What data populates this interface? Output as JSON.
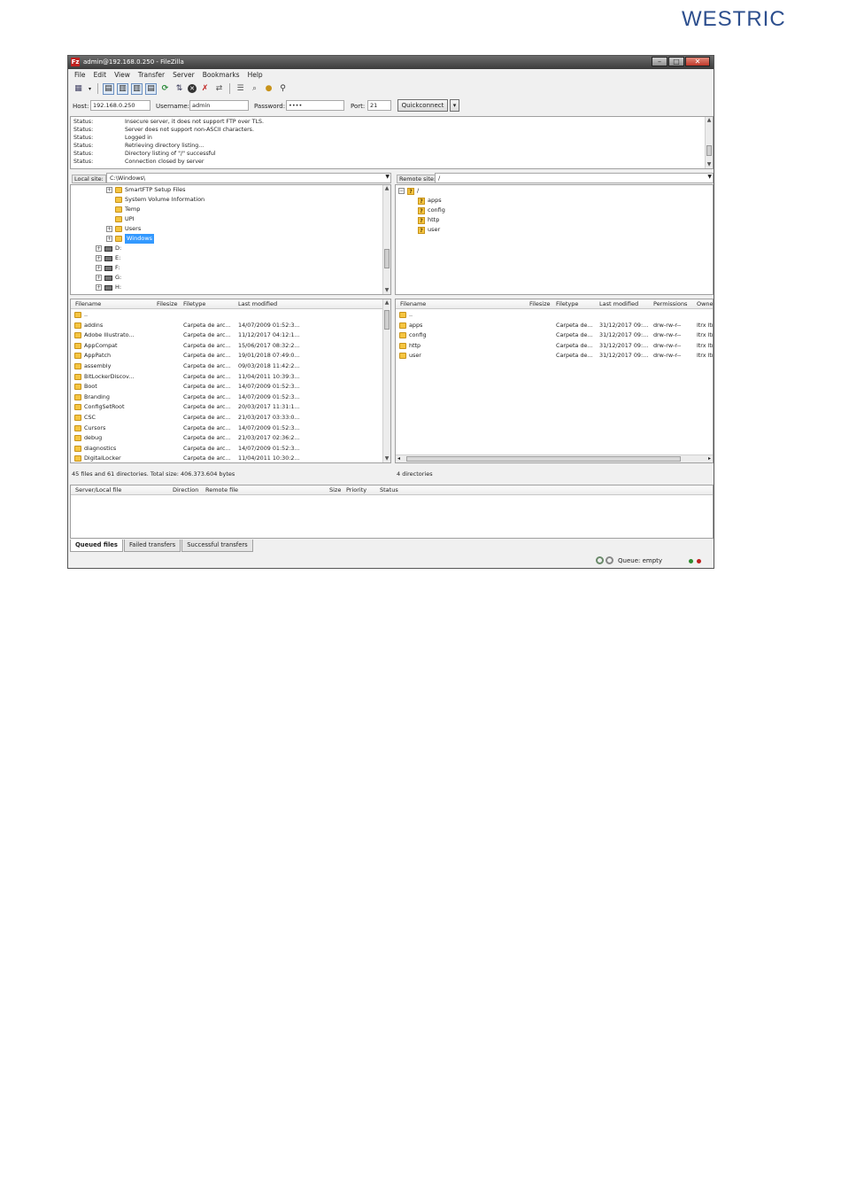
{
  "brand": "WESTRIC",
  "window": {
    "title": "admin@192.168.0.250 - FileZilla",
    "app_icon": "filezilla-icon",
    "controls": [
      "minimize",
      "maximize",
      "close"
    ]
  },
  "menu": [
    "File",
    "Edit",
    "View",
    "Transfer",
    "Server",
    "Bookmarks",
    "Help"
  ],
  "toolbar": {
    "icons": [
      "site-manager-icon",
      "dropdown-icon",
      "toggle-log-icon",
      "toggle-local-tree-icon",
      "toggle-remote-tree-icon",
      "toggle-queue-icon",
      "refresh-icon",
      "process-queue-icon",
      "cancel-icon",
      "disconnect-icon",
      "reconnect-icon",
      "filter-icon",
      "compare-icon",
      "sync-browse-icon",
      "search-icon"
    ]
  },
  "quickconnect": {
    "host_label": "Host:",
    "host_value": "192.168.0.250",
    "username_label": "Username:",
    "username_value": "admin",
    "password_label": "Password:",
    "password_value": "••••",
    "port_label": "Port:",
    "port_value": "21",
    "button_label": "Quickconnect",
    "dropdown_glyph": "▾"
  },
  "log": [
    {
      "key": "Status:",
      "msg": "Insecure server, it does not support FTP over TLS."
    },
    {
      "key": "Status:",
      "msg": "Server does not support non-ASCII characters."
    },
    {
      "key": "Status:",
      "msg": "Logged in"
    },
    {
      "key": "Status:",
      "msg": "Retrieving directory listing..."
    },
    {
      "key": "Status:",
      "msg": "Directory listing of \"/\" successful"
    },
    {
      "key": "Status:",
      "msg": "Connection closed by server"
    }
  ],
  "local": {
    "site_label": "Local site:",
    "site_path": "C:\\Windows\\",
    "tree": [
      {
        "label": "SmartFTP Setup Files",
        "type": "folder",
        "expander": "+"
      },
      {
        "label": "System Volume Information",
        "type": "folder",
        "expander": ""
      },
      {
        "label": "Temp",
        "type": "folder",
        "expander": ""
      },
      {
        "label": "UPI",
        "type": "folder",
        "expander": ""
      },
      {
        "label": "Users",
        "type": "folder",
        "expander": "+"
      },
      {
        "label": "Windows",
        "type": "folder",
        "expander": "+",
        "selected": true
      },
      {
        "label": "D:",
        "type": "drive",
        "expander": "+"
      },
      {
        "label": "E:",
        "type": "drive",
        "expander": "+"
      },
      {
        "label": "F:",
        "type": "drive",
        "expander": "+"
      },
      {
        "label": "G:",
        "type": "drive",
        "expander": "+"
      },
      {
        "label": "H:",
        "type": "drive",
        "expander": "+"
      }
    ],
    "columns": [
      "Filename",
      "Filesize",
      "Filetype",
      "Last modified"
    ],
    "files": [
      {
        "name": "..",
        "type": "",
        "modified": ""
      },
      {
        "name": "addins",
        "type": "Carpeta de arc...",
        "modified": "14/07/2009 01:52:3..."
      },
      {
        "name": "Adobe Illustrato...",
        "type": "Carpeta de arc...",
        "modified": "11/12/2017 04:12:1..."
      },
      {
        "name": "AppCompat",
        "type": "Carpeta de arc...",
        "modified": "15/06/2017 08:32:2..."
      },
      {
        "name": "AppPatch",
        "type": "Carpeta de arc...",
        "modified": "19/01/2018 07:49:0..."
      },
      {
        "name": "assembly",
        "type": "Carpeta de arc...",
        "modified": "09/03/2018 11:42:2..."
      },
      {
        "name": "BitLockerDiscov...",
        "type": "Carpeta de arc...",
        "modified": "11/04/2011 10:39:3..."
      },
      {
        "name": "Boot",
        "type": "Carpeta de arc...",
        "modified": "14/07/2009 01:52:3..."
      },
      {
        "name": "Branding",
        "type": "Carpeta de arc...",
        "modified": "14/07/2009 01:52:3..."
      },
      {
        "name": "ConfigSetRoot",
        "type": "Carpeta de arc...",
        "modified": "20/03/2017 11:31:1..."
      },
      {
        "name": "CSC",
        "type": "Carpeta de arc...",
        "modified": "21/03/2017 03:33:0..."
      },
      {
        "name": "Cursors",
        "type": "Carpeta de arc...",
        "modified": "14/07/2009 01:52:3..."
      },
      {
        "name": "debug",
        "type": "Carpeta de arc...",
        "modified": "21/03/2017 02:36:2..."
      },
      {
        "name": "diagnostics",
        "type": "Carpeta de arc...",
        "modified": "14/07/2009 01:52:3..."
      },
      {
        "name": "DigitalLocker",
        "type": "Carpeta de arc...",
        "modified": "11/04/2011 10:30:2..."
      }
    ],
    "status": "45 files and 61 directories. Total size: 406.373.604 bytes"
  },
  "remote": {
    "site_label": "Remote site:",
    "site_path": "/",
    "tree_root": "/",
    "tree": [
      "apps",
      "config",
      "http",
      "user"
    ],
    "columns": [
      "Filename",
      "Filesize",
      "Filetype",
      "Last modified",
      "Permissions",
      "Owne"
    ],
    "files": [
      {
        "name": "..",
        "type": "",
        "modified": "",
        "perms": "",
        "owner": ""
      },
      {
        "name": "apps",
        "type": "Carpeta de...",
        "modified": "31/12/2017 09:...",
        "perms": "drw-rw-r--",
        "owner": "ltrx ltr"
      },
      {
        "name": "config",
        "type": "Carpeta de...",
        "modified": "31/12/2017 09:...",
        "perms": "drw-rw-r--",
        "owner": "ltrx ltr"
      },
      {
        "name": "http",
        "type": "Carpeta de...",
        "modified": "31/12/2017 09:...",
        "perms": "drw-rw-r--",
        "owner": "ltrx ltr"
      },
      {
        "name": "user",
        "type": "Carpeta de...",
        "modified": "31/12/2017 09:...",
        "perms": "drw-rw-r--",
        "owner": "ltrx ltr"
      }
    ],
    "status": "4 directories"
  },
  "queue": {
    "columns": [
      "Server/Local file",
      "Direction",
      "Remote file",
      "Size",
      "Priority",
      "Status"
    ],
    "tabs": [
      "Queued files",
      "Failed transfers",
      "Successful transfers"
    ],
    "status_text": "Queue: empty"
  },
  "colors": {
    "selection": "#3399ff",
    "folder": "#f5c542",
    "led_green": "#2e8b2e",
    "led_red": "#c0211f"
  }
}
